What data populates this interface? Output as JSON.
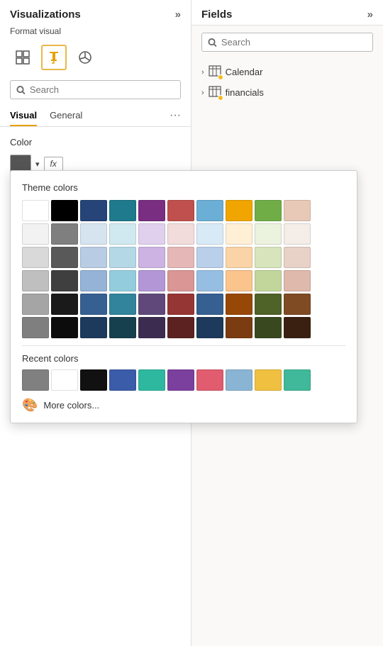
{
  "left_panel": {
    "title": "Visualizations",
    "expand_icon": "»",
    "format_visual_label": "Format visual",
    "search_placeholder": "Search",
    "tabs": [
      {
        "label": "Visual",
        "active": true
      },
      {
        "label": "General",
        "active": false
      }
    ],
    "more_icon": "···",
    "color_label": "Color",
    "fx_label": "fx"
  },
  "right_panel": {
    "title": "Fields",
    "expand_icon": "»",
    "search_placeholder": "Search",
    "fields": [
      {
        "name": "Calendar"
      },
      {
        "name": "financials"
      }
    ]
  },
  "color_picker": {
    "theme_colors_label": "Theme colors",
    "recent_colors_label": "Recent colors",
    "more_colors_label": "More colors...",
    "theme_rows": [
      [
        "#ffffff",
        "#000000",
        "#264478",
        "#1f7a8c",
        "#7a2e82",
        "#c0504d",
        "#6baed6",
        "#f0a500",
        "#70ad47",
        "#e8d5c4"
      ],
      [
        "#f2f2f2",
        "#7f7f7f",
        "#dce6f1",
        "#daeef3",
        "#e6d0f0",
        "#f2dbdb",
        "#dce9f5",
        "#fdefd3",
        "#ebf1de",
        "#f4ece8"
      ],
      [
        "#d8d8d8",
        "#595959",
        "#b8cce4",
        "#b6dde8",
        "#cdb3e3",
        "#e5b8b7",
        "#b9d0ea",
        "#fbd5a5",
        "#d7e4bc",
        "#ead2c7"
      ],
      [
        "#bfbfbf",
        "#3f3f3f",
        "#95b3d7",
        "#93cddd",
        "#b396d6",
        "#d99694",
        "#95bee2",
        "#fac48c",
        "#c2d69b",
        "#e1bfab"
      ],
      [
        "#a5a5a5",
        "#262626",
        "#376092",
        "#31849b",
        "#60497a",
        "#963634",
        "#366092",
        "#974706",
        "#4f6228",
        "#7f4b23"
      ],
      [
        "#7f7f7f",
        "#0c0c0c",
        "#243f60",
        "#215968",
        "#3e3050",
        "#632424",
        "#243f60",
        "#632f02",
        "#343f18",
        "#543118"
      ]
    ],
    "recent_row": [
      "#808080",
      "#ffffff",
      "#000000",
      "#3b5ca8",
      "#2eb8a0",
      "#7b3f9e",
      "#e05c6e",
      "#8ab4d4",
      "#f0c040",
      "#40b89a"
    ]
  }
}
